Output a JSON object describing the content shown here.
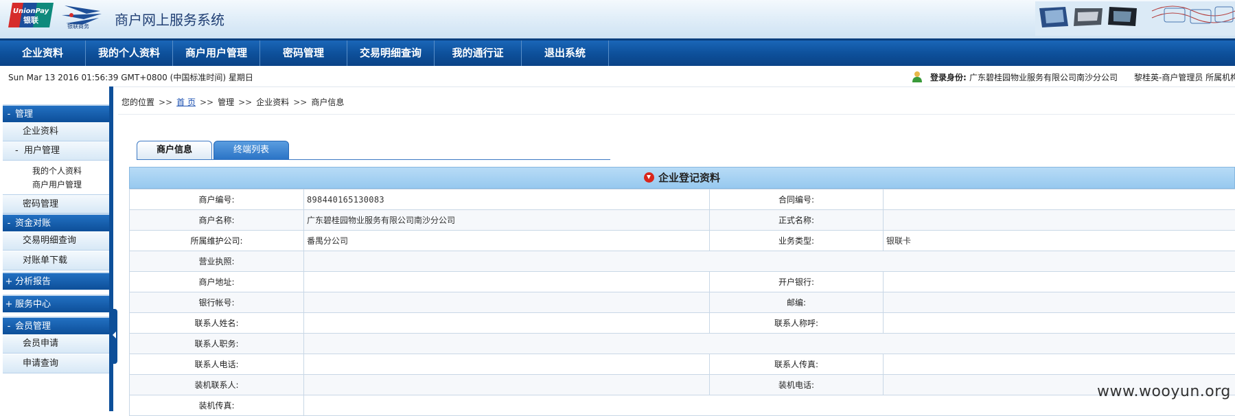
{
  "header": {
    "logo_unionpay_top": "UnionPay",
    "logo_unionpay_bottom": "银联",
    "logo_chinaums": "银联商务",
    "title": "商户网上服务系统"
  },
  "nav": {
    "items": [
      "企业资料",
      "我的个人资料",
      "商户用户管理",
      "密码管理",
      "交易明细查询",
      "我的通行证",
      "退出系统"
    ]
  },
  "status": {
    "datetime": "Sun Mar 13 2016 01:56:39 GMT+0800 (中国标准时间) 星期日",
    "login_label": "登录身份:",
    "login_value": "广东碧桂园物业服务有限公司南沙分公司　　黎桂英-商户管理员 所属机构-"
  },
  "sidebar": {
    "sections": [
      {
        "marker": "-",
        "label": "管理"
      },
      {
        "marker": "-",
        "label": "资金对账"
      },
      {
        "marker": "+",
        "label": "分析报告"
      },
      {
        "marker": "+",
        "label": "服务中心"
      },
      {
        "marker": "-",
        "label": "会员管理"
      }
    ],
    "items": {
      "enterprise": "企业资料",
      "user_mgmt_marker": "-",
      "user_mgmt": "用户管理",
      "my_profile": "我的个人资料",
      "merchant_users": "商户用户管理",
      "password": "密码管理",
      "txn_query": "交易明细查询",
      "statement_dl": "对账单下载",
      "member_apply": "会员申请",
      "apply_query": "申请查询"
    }
  },
  "breadcrumb": {
    "prefix": "您的位置",
    "sep": ">>",
    "home": "首 页",
    "path": [
      "管理",
      "企业资料",
      "商户信息"
    ]
  },
  "tabs": [
    "商户信息",
    "终端列表"
  ],
  "panel": {
    "title": "企业登记资料"
  },
  "form": {
    "merchant_no_label": "商户编号:",
    "merchant_no": "898440165130083",
    "contract_no_label": "合同编号:",
    "contract_no": "",
    "merchant_name_label": "商户名称:",
    "merchant_name": "广东碧桂园物业服务有限公司南沙分公司",
    "formal_name_label": "正式名称:",
    "formal_name": "",
    "maint_company_label": "所属维护公司:",
    "maint_company": "番禺分公司",
    "biz_type_label": "业务类型:",
    "biz_type": "银联卡",
    "license_label": "营业执照:",
    "license": "",
    "address_label": "商户地址:",
    "address": "",
    "bank_label": "开户银行:",
    "bank": "",
    "account_label": "银行帐号:",
    "account": "",
    "postcode_label": "邮编:",
    "postcode": "",
    "contact_name_label": "联系人姓名:",
    "contact_name": "",
    "contact_title_label": "联系人称呼:",
    "contact_title": "",
    "contact_position_label": "联系人职务:",
    "contact_position": "",
    "contact_phone_label": "联系人电话:",
    "contact_phone": "",
    "contact_fax_label": "联系人传真:",
    "contact_fax": "",
    "install_contact_label": "装机联系人:",
    "install_contact": "",
    "install_phone_label": "装机电话:",
    "install_phone": "",
    "install_fax_label": "装机传真:",
    "install_fax": ""
  },
  "watermark": "www.wooyun.org"
}
